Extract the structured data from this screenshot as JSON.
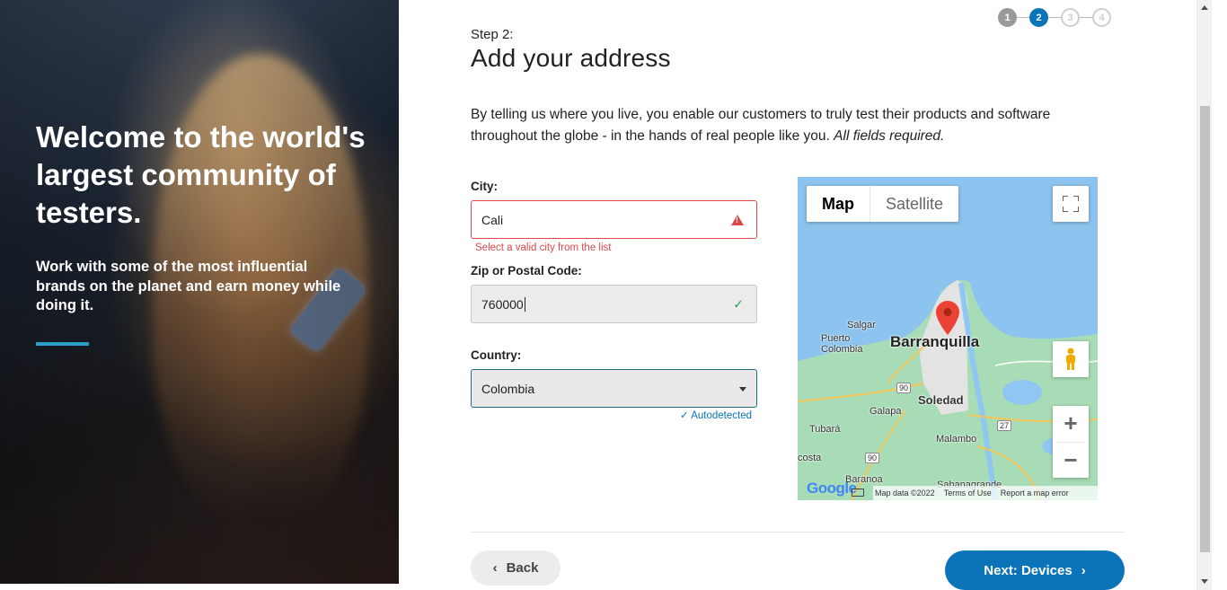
{
  "hero": {
    "headline": "Welcome to the world's largest community of testers.",
    "subtext": "Work with some of the most influential brands on the planet and earn money while doing it."
  },
  "stepper": {
    "steps": [
      "1",
      "2",
      "3",
      "4"
    ],
    "active_step": 2
  },
  "page": {
    "step_label": "Step 2:",
    "title": "Add your address",
    "intro": "By telling us where you live, you enable our customers to truly test their products and software throughout the globe - in the hands of real people like you.",
    "intro_emphasis": "All fields required."
  },
  "form": {
    "city": {
      "label": "City:",
      "value": "Cali",
      "error": "Select a valid city from the list"
    },
    "zip": {
      "label": "Zip or Postal Code:",
      "value": "760000"
    },
    "country": {
      "label": "Country:",
      "value": "Colombia",
      "note": "Autodetected"
    }
  },
  "map": {
    "type_map": "Map",
    "type_satellite": "Satellite",
    "labels": {
      "barranquilla": "Barranquilla",
      "soledad": "Soledad",
      "salgar": "Salgar",
      "puerto_colombia": "Puerto Colombia",
      "galapa": "Galapa",
      "tubara": "Tubará",
      "malambo": "Malambo",
      "costa": "costa",
      "baranoa": "Baranoa",
      "sabanagrande": "Sabanagrande",
      "route_90a": "90",
      "route_90b": "90",
      "route_27": "27"
    },
    "logo": "Google",
    "attribution": "Map data ©2022",
    "terms": "Terms of Use",
    "report": "Report a map error"
  },
  "nav": {
    "back": "Back",
    "next": "Next: Devices"
  },
  "colors": {
    "primary": "#0b74b8",
    "error": "#e0474c",
    "accent": "#2aa0c7",
    "success": "#2aa05a"
  }
}
